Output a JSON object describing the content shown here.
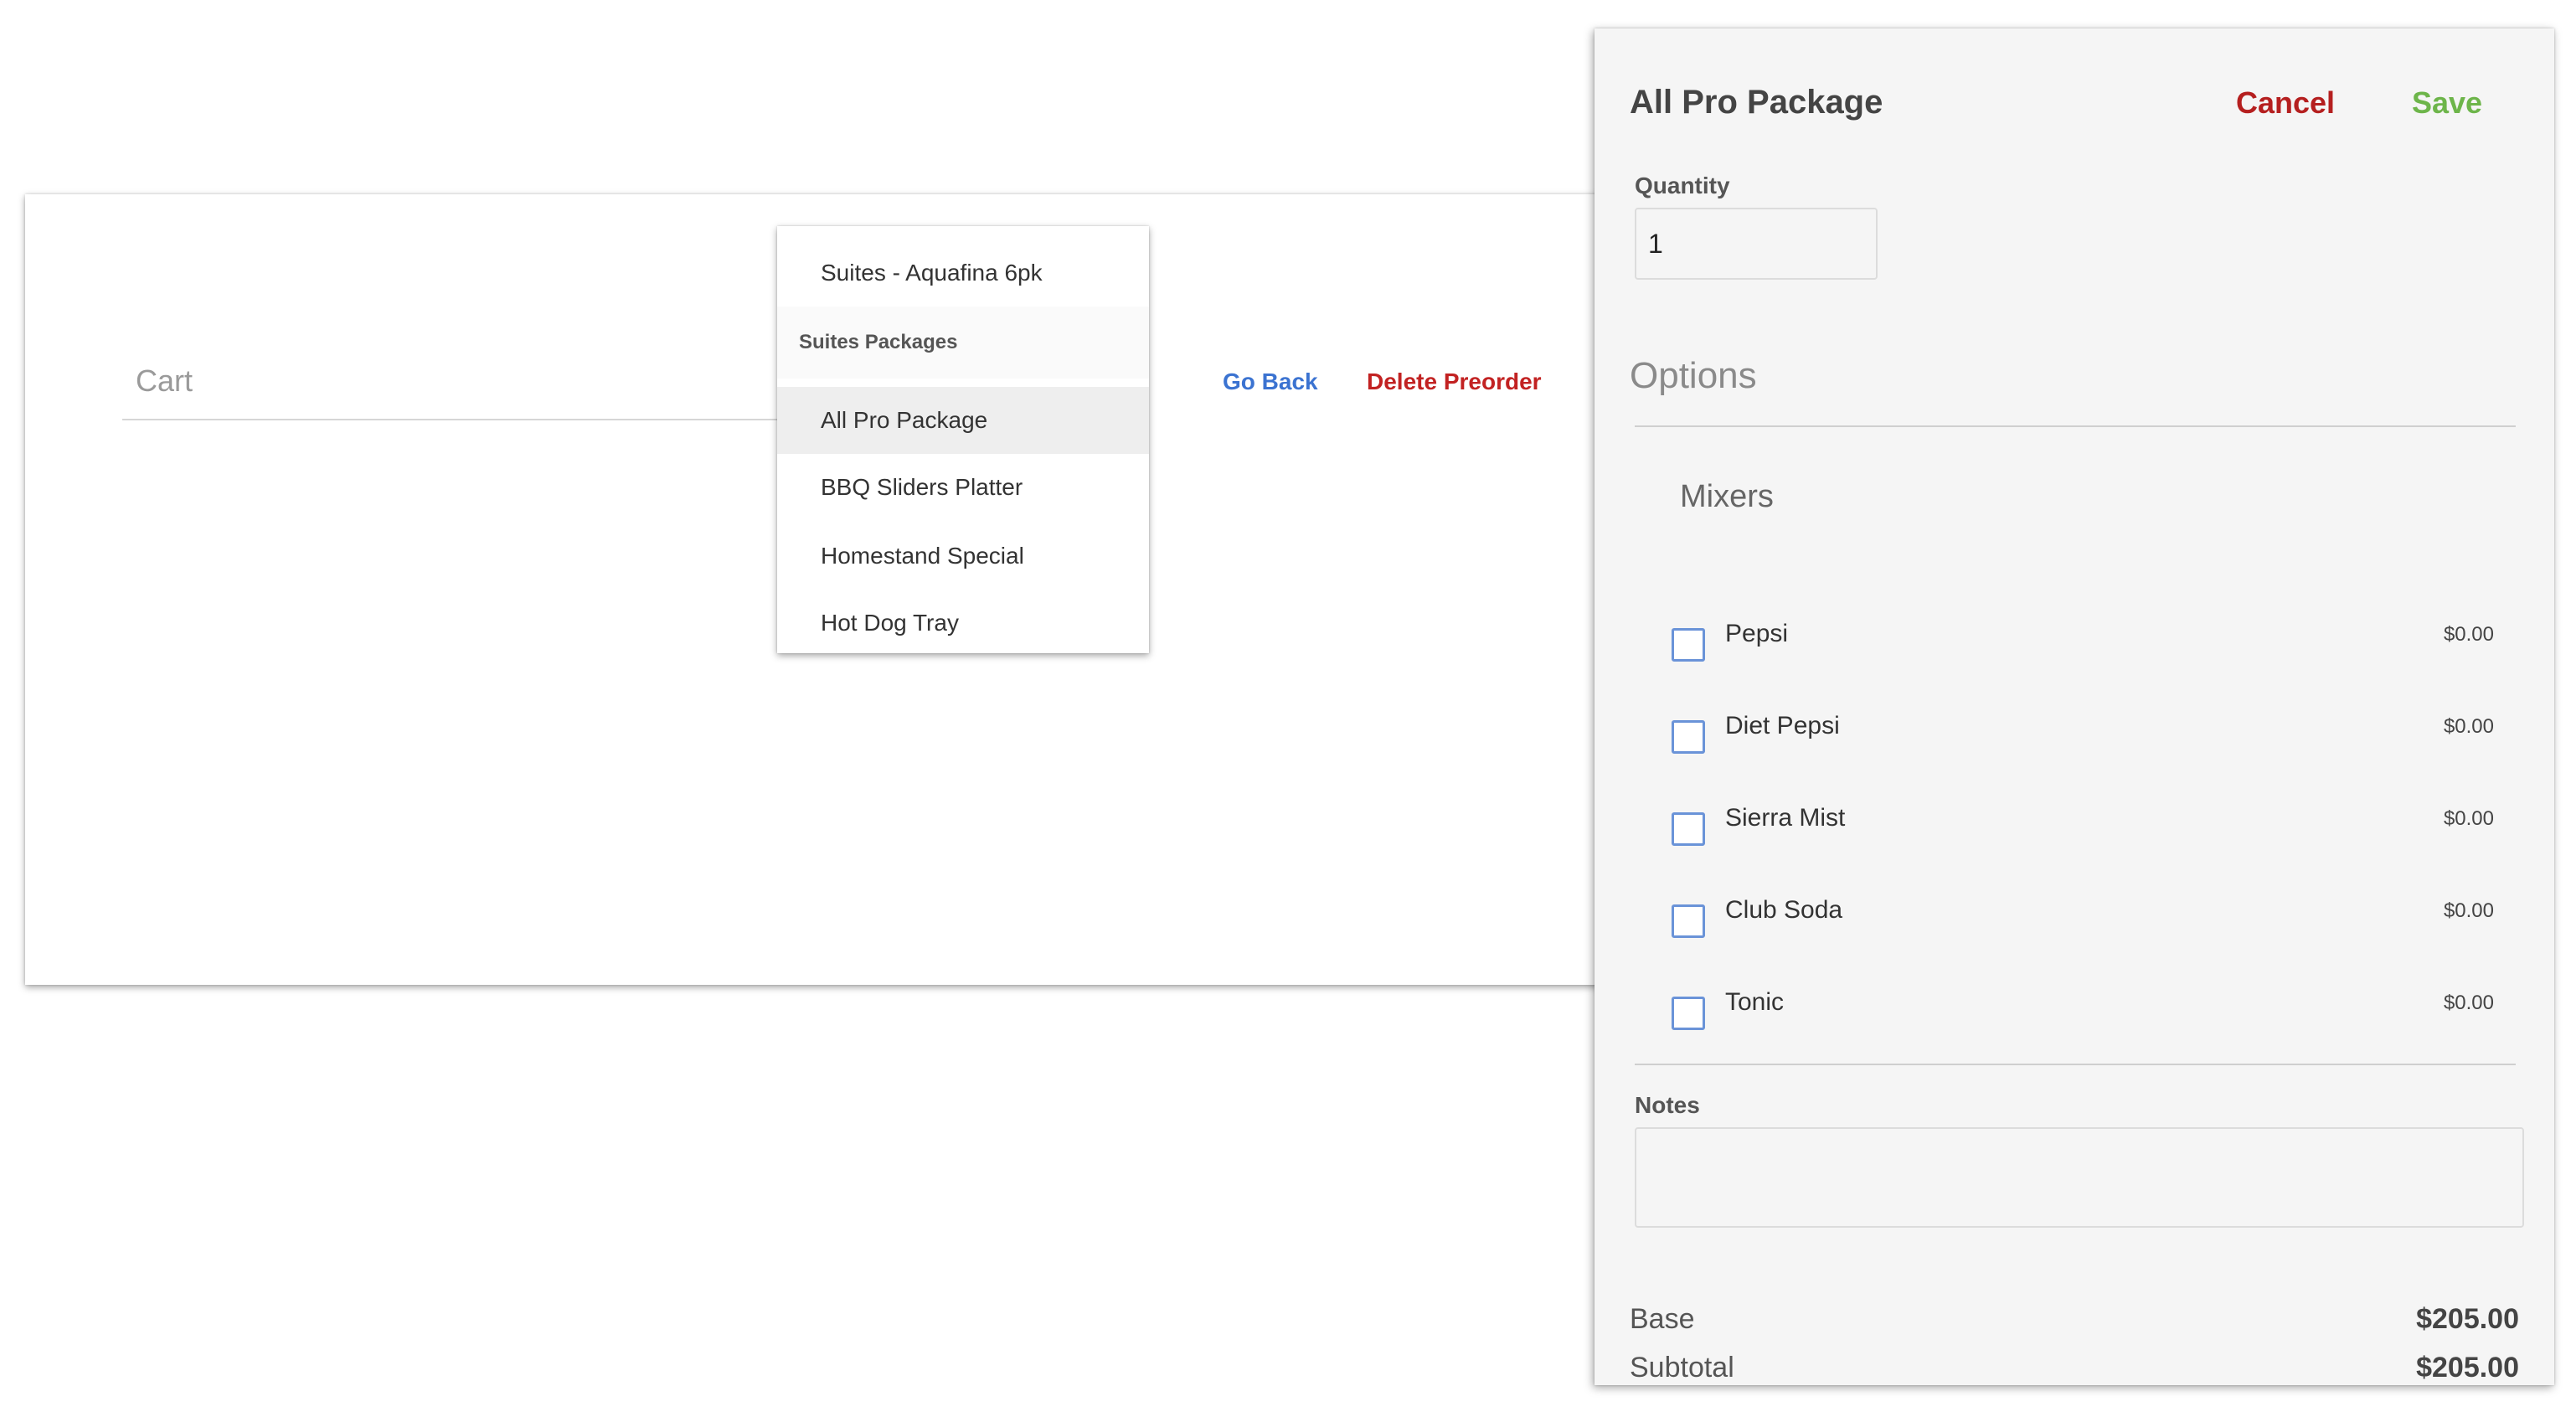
{
  "cart": {
    "label": "Cart",
    "go_back": "Go Back",
    "delete_preorder": "Delete Preorder"
  },
  "dropdown": {
    "items": [
      {
        "label": "Suites - Aquafina 6pk",
        "selected": false
      },
      {
        "group": "Suites Packages"
      },
      {
        "label": "All Pro Package",
        "selected": true
      },
      {
        "label": "BBQ Sliders Platter",
        "selected": false
      },
      {
        "label": "Homestand Special",
        "selected": false
      },
      {
        "label": "Hot Dog Tray",
        "selected": false
      }
    ]
  },
  "panel": {
    "title": "All Pro Package",
    "cancel": "Cancel",
    "save": "Save",
    "quantity_label": "Quantity",
    "quantity_value": "1",
    "options_title": "Options",
    "group_title": "Mixers",
    "options": [
      {
        "name": "Pepsi",
        "price": "$0.00",
        "checked": false
      },
      {
        "name": "Diet Pepsi",
        "price": "$0.00",
        "checked": false
      },
      {
        "name": "Sierra Mist",
        "price": "$0.00",
        "checked": false
      },
      {
        "name": "Club Soda",
        "price": "$0.00",
        "checked": false
      },
      {
        "name": "Tonic",
        "price": "$0.00",
        "checked": false
      }
    ],
    "notes_label": "Notes",
    "notes_value": "",
    "base_label": "Base",
    "base_value": "$205.00",
    "subtotal_label": "Subtotal",
    "subtotal_value": "$205.00"
  },
  "colors": {
    "link_blue": "#3b73d1",
    "danger_red": "#c22222",
    "save_green": "#6db54a",
    "checkbox_blue": "#6a93d8"
  }
}
